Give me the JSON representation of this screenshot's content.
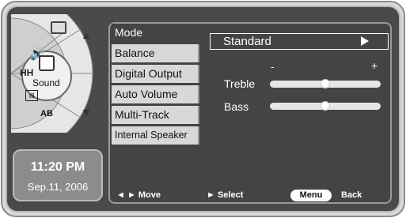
{
  "colors": {
    "panel_bg": "#444444",
    "panel_border": "#9a9a9a",
    "menu_item_bg": "#d8d8d8",
    "dial_light": "#e6e6e6",
    "dial_dark": "#555555",
    "clock_bg": "#8c8c8c"
  },
  "dial": {
    "center_label": "Sound",
    "icons": [
      "tv-screen-icon",
      "speaker-icon",
      "antenna-icon",
      "setup-icon",
      "ab-icon"
    ],
    "ab_label": "AB",
    "up_arrow": "▲",
    "down_arrow": "▼"
  },
  "clock": {
    "time": "11:20 PM",
    "date": "Sep.11, 2006"
  },
  "menu": {
    "items": [
      {
        "label": "Mode"
      },
      {
        "label": "Balance"
      },
      {
        "label": "Digital Output"
      },
      {
        "label": "Auto Volume"
      },
      {
        "label": "Multi-Track"
      },
      {
        "label": "Internal Speaker"
      }
    ],
    "mode_value": "Standard",
    "scale_minus": "-",
    "scale_plus": "+",
    "treble": {
      "label": "Treble",
      "level": 0.5
    },
    "bass": {
      "label": "Bass",
      "level": 0.5
    }
  },
  "nav": {
    "move_label": "◄ ► Move",
    "select_label": "► Select",
    "menu_label": "Menu",
    "back_label": "Back"
  }
}
